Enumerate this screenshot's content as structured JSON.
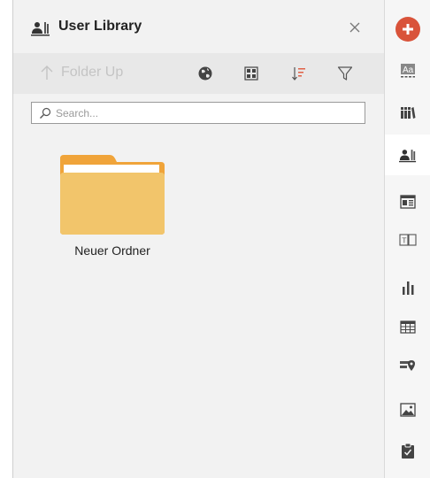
{
  "panel": {
    "title": "User Library",
    "title_icon": "user-library-icon",
    "close_icon": "close-icon"
  },
  "toolbar": {
    "folder_up_label": "Folder Up",
    "buttons": [
      "globe-icon",
      "grid-view-icon",
      "sort-icon",
      "filter-icon"
    ]
  },
  "search": {
    "placeholder": "Search...",
    "value": ""
  },
  "items": [
    {
      "name": "Neuer Ordner",
      "type": "folder"
    }
  ],
  "sidebar": {
    "items": [
      "add-element-icon",
      "text-style-icon",
      "library-icon",
      "user-library-icon",
      "panel-layout-icon",
      "text-frame-icon",
      "bar-chart-icon",
      "table-icon",
      "map-marker-icon",
      "image-icon",
      "clipboard-check-icon"
    ],
    "active": "user-library-icon"
  },
  "colors": {
    "accent": "#d9533a",
    "folder": "#f2c56b",
    "folder_dark": "#f0a43a",
    "sort_accent": "#e06046"
  }
}
